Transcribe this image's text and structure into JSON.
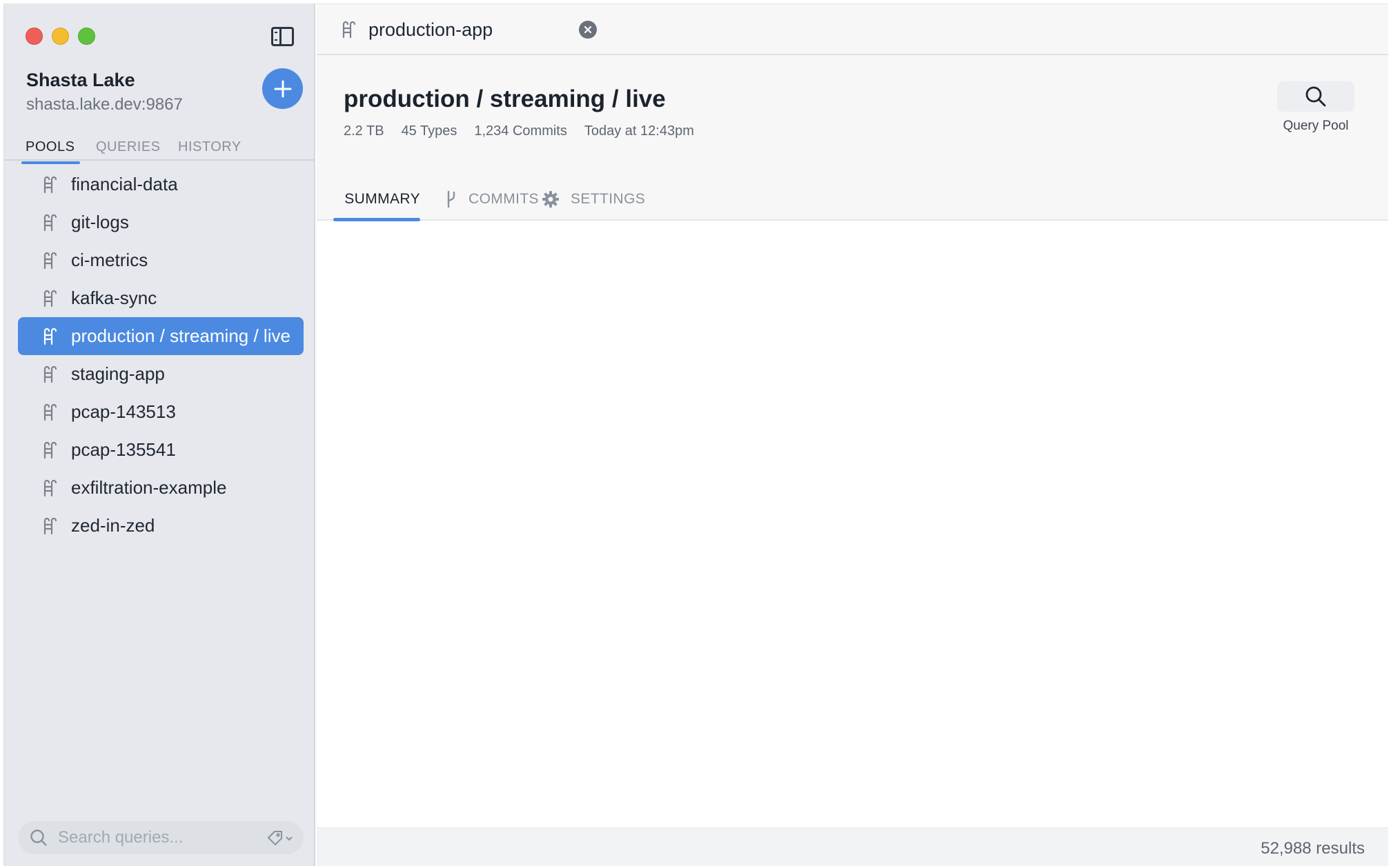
{
  "lake": {
    "name": "Shasta Lake",
    "host": "shasta.lake.dev:9867"
  },
  "sidebar": {
    "tabs": [
      "POOLS",
      "QUERIES",
      "HISTORY"
    ],
    "active_tab": "POOLS",
    "pools": [
      {
        "label": "financial-data",
        "selected": false
      },
      {
        "label": "git-logs",
        "selected": false
      },
      {
        "label": "ci-metrics",
        "selected": false
      },
      {
        "label": "kafka-sync",
        "selected": false
      },
      {
        "label": "production / streaming / live",
        "selected": true
      },
      {
        "label": "staging-app",
        "selected": false
      },
      {
        "label": "pcap-143513",
        "selected": false
      },
      {
        "label": "pcap-135541",
        "selected": false
      },
      {
        "label": "exfiltration-example",
        "selected": false
      },
      {
        "label": "zed-in-zed",
        "selected": false
      }
    ],
    "search": {
      "placeholder": "Search queries...",
      "value": ""
    }
  },
  "tab": {
    "label": "production-app"
  },
  "pool": {
    "title": "production / streaming / live",
    "size": "2.2 TB",
    "types": "45 Types",
    "commits": "1,234 Commits",
    "updated": "Today at 12:43pm"
  },
  "query_button": {
    "label": "Query Pool"
  },
  "view_tabs": [
    {
      "label": "SUMMARY",
      "icon": "bar-chart-icon",
      "active": true
    },
    {
      "label": "COMMITS",
      "icon": "branch-icon",
      "active": false
    },
    {
      "label": "SETTINGS",
      "icon": "gear-icon",
      "active": false
    }
  ],
  "status": {
    "results": "52,988 results"
  },
  "colors": {
    "accent": "#4b8ae0",
    "sidebar_bg": "#e6e8ed",
    "traffic_red": "#ed5f58",
    "traffic_yellow": "#f5bc31",
    "traffic_green": "#5fc23f"
  }
}
